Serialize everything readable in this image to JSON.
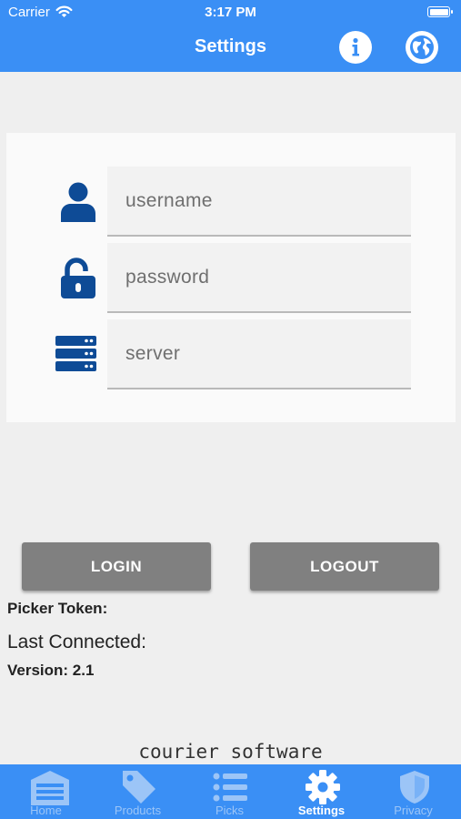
{
  "status_bar": {
    "carrier": "Carrier",
    "time": "3:17 PM"
  },
  "nav": {
    "title": "Settings",
    "left_icon": "info-icon",
    "right_icon": "globe-icon"
  },
  "form": {
    "username": {
      "placeholder": "username",
      "value": ""
    },
    "password": {
      "placeholder": "password",
      "value": ""
    },
    "server": {
      "placeholder": "server",
      "value": ""
    }
  },
  "buttons": {
    "login": "LOGIN",
    "logout": "LOGOUT"
  },
  "info": {
    "picker_token": "Picker Token:",
    "last_connected": "Last Connected:",
    "version": "Version: 2.1"
  },
  "brand": "courier software",
  "tabs": [
    {
      "label": "Home",
      "icon": "garage-icon",
      "active": false
    },
    {
      "label": "Products",
      "icon": "tag-icon",
      "active": false
    },
    {
      "label": "Picks",
      "icon": "list-icon",
      "active": false
    },
    {
      "label": "Settings",
      "icon": "gear-icon",
      "active": true
    },
    {
      "label": "Privacy",
      "icon": "shield-icon",
      "active": false
    }
  ],
  "colors": {
    "accent": "#3a8ff5",
    "icon_blue": "#0e4b96",
    "button_gray": "#808080",
    "tab_inactive": "#9cc5f7"
  }
}
